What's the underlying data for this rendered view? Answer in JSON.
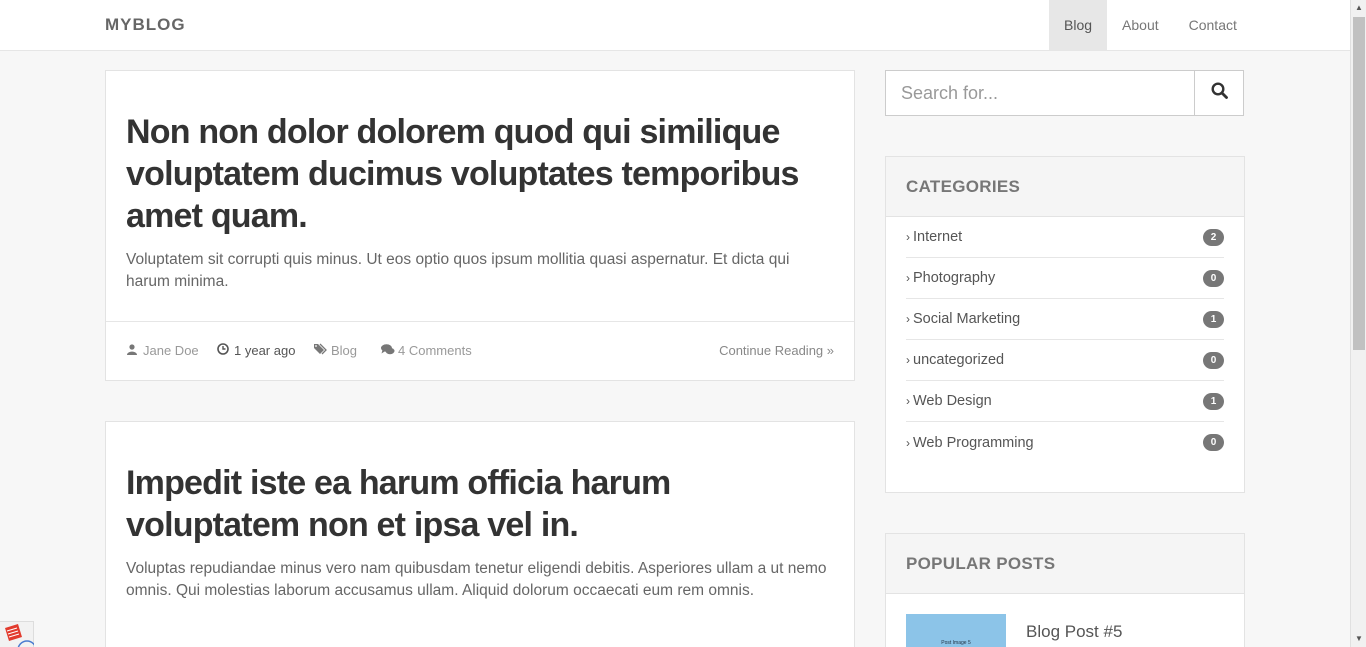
{
  "navbar": {
    "brand": "MYBLOG",
    "items": [
      {
        "label": "Blog",
        "active": true
      },
      {
        "label": "About",
        "active": false
      },
      {
        "label": "Contact",
        "active": false
      }
    ]
  },
  "posts": [
    {
      "title": "Non non dolor dolorem quod qui similique voluptatem ducimus voluptates temporibus amet quam.",
      "excerpt": "Voluptatem sit corrupti quis minus. Ut eos optio quos ipsum mollitia quasi aspernatur. Et dicta qui harum minima.",
      "author": "Jane Doe",
      "time": "1 year ago",
      "category": "Blog",
      "comments": "4 Comments",
      "continue": "Continue Reading »"
    },
    {
      "title": "Impedit iste ea harum officia harum voluptatem non et ipsa vel in.",
      "excerpt": "Voluptas repudiandae minus vero nam quibusdam tenetur eligendi debitis. Asperiores ullam a ut nemo omnis. Qui molestias laborum accusamus ullam. Aliquid dolorum occaecati eum rem omnis."
    }
  ],
  "search": {
    "placeholder": "Search for..."
  },
  "categories": {
    "heading": "CATEGORIES",
    "items": [
      {
        "label": "Internet",
        "count": "2"
      },
      {
        "label": "Photography",
        "count": "0"
      },
      {
        "label": "Social Marketing",
        "count": "1"
      },
      {
        "label": "uncategorized",
        "count": "0"
      },
      {
        "label": "Web Design",
        "count": "1"
      },
      {
        "label": "Web Programming",
        "count": "0"
      }
    ]
  },
  "popular": {
    "heading": "POPULAR POSTS",
    "items": [
      {
        "title": "Blog Post #5",
        "thumb_text": "Post Image 5"
      }
    ]
  },
  "colors": {
    "accent": "#777777",
    "background": "#f7f7f7"
  }
}
